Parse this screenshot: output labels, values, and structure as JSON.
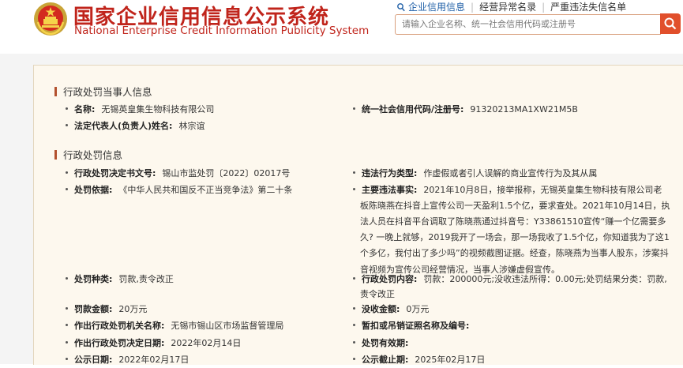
{
  "header": {
    "title_cn": "国家企业信用信息公示系统",
    "title_en": "National Enterprise Credit Information Publicity System",
    "links": [
      "企业信用信息",
      "经营异常名录",
      "严重违法失信名单"
    ],
    "search_placeholder": "请输入企业名称、统一社会信用代码或注册号",
    "accent_color": "#c0241b",
    "search_button_color": "#e14f2b"
  },
  "party_section": {
    "title": "行政处罚当事人信息",
    "name_label": "名称:",
    "name_value": "无锡英皇集生物科技有限公司",
    "credit_label": "统一社会信用代码/注册号:",
    "credit_value": "91320213MA1XW21M5B",
    "legal_label": "法定代表人(负责人)姓名:",
    "legal_value": "林宗谊"
  },
  "penalty_section": {
    "title": "行政处罚信息",
    "doc_label": "行政处罚决定书文号:",
    "doc_value": "锡山市监处罚〔2022〕02017号",
    "violation_type_label": "违法行为类型:",
    "violation_type_value": "作虚假或者引人误解的商业宣传行为及其从属",
    "basis_label": "处罚依据:",
    "basis_value": "《中华人民共和国反不正当竞争法》第二十条",
    "facts_label": "主要违法事实:",
    "facts_lines": [
      "2021年10月8日，接举报称，无锡英皇集生物科技有限公司老",
      "板陈晓燕在抖音上宣传公司一天盈利1.5个亿，要求查处。2021年10月14日，执",
      "法人员在抖音平台调取了陈晓燕通过抖音号：Y33861510宣传“赚一个亿需要多",
      "久? 一晚上就够，2019我开了一场会，那一场我收了1.5个亿，你知道我为了这1",
      "个多亿，我付出了多少吗”的视频截图证据。经查，陈晓燕为当事人股东，涉案抖",
      "音视频为宣传公司经营情况，当事人涉嫌虚假宣传。"
    ],
    "kind_label": "处罚种类:",
    "kind_value": "罚款,责令改正",
    "content_label": "行政处罚内容:",
    "content_line1": "罚款：200000元;没收违法所得：0.00元;处罚结果分类：罚款,",
    "content_line2": "责令改正",
    "amount_label": "罚款金额:",
    "amount_value": "20万元",
    "confiscated_label": "没收金额:",
    "confiscated_value": "0万元",
    "authority_label": "作出行政处罚机关名称:",
    "authority_value": "无锡市锡山区市场监督管理局",
    "license_label": "暂扣或吊销证照名称及编号:",
    "license_value": "",
    "decision_date_label": "作出行政处罚决定日期:",
    "decision_date_value": "2022年02月14日",
    "validity_label": "处罚有效期:",
    "validity_value": "",
    "publish_date_label": "公示日期:",
    "publish_date_value": "2022年02月17日",
    "publish_end_label": "公示截止期:",
    "publish_end_value": "2025年02月17日"
  }
}
